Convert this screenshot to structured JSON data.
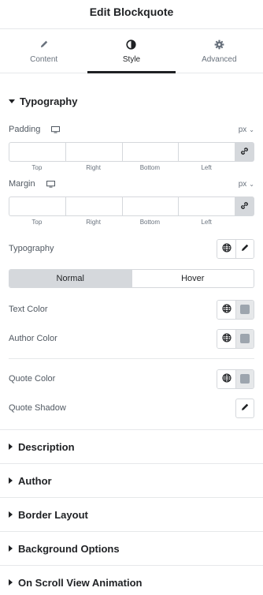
{
  "header": {
    "title": "Edit Blockquote"
  },
  "tabs": [
    {
      "label": "Content",
      "icon": "pencil-icon"
    },
    {
      "label": "Style",
      "icon": "contrast-icon"
    },
    {
      "label": "Advanced",
      "icon": "gear-icon"
    }
  ],
  "active_tab": "Style",
  "typography_section": {
    "title": "Typography",
    "padding": {
      "label": "Padding",
      "unit": "px",
      "sides": [
        "Top",
        "Right",
        "Bottom",
        "Left"
      ]
    },
    "margin": {
      "label": "Margin",
      "unit": "px",
      "sides": [
        "Top",
        "Right",
        "Bottom",
        "Left"
      ]
    },
    "typography_label": "Typography",
    "state_switch": {
      "normal": "Normal",
      "hover": "Hover",
      "selected": "Normal"
    },
    "text_color_label": "Text Color",
    "author_color_label": "Author Color",
    "quote_color_label": "Quote Color",
    "quote_shadow_label": "Quote Shadow",
    "swatch_color": "#9da5ae"
  },
  "collapsed_sections": [
    "Description",
    "Author",
    "Border Layout",
    "Background Options",
    "On Scroll View Animation"
  ]
}
